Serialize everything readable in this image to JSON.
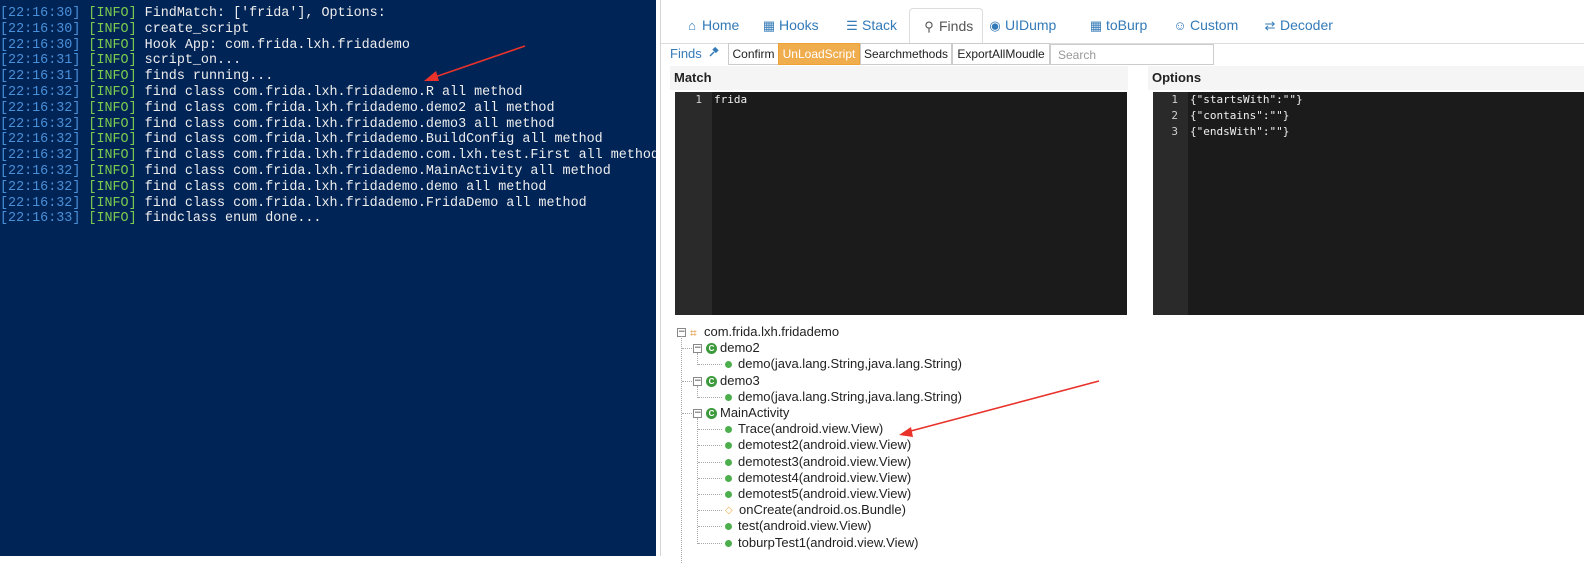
{
  "terminal": {
    "lines": [
      {
        "time": "[22:16:30]",
        "level": "[INFO]",
        "msg": "FindMatch: ['frida'], Options:"
      },
      {
        "time": "[22:16:30]",
        "level": "[INFO]",
        "msg": "create_script"
      },
      {
        "time": "[22:16:30]",
        "level": "[INFO]",
        "msg": "Hook App: com.frida.lxh.fridademo"
      },
      {
        "time": "[22:16:31]",
        "level": "[INFO]",
        "msg": "script_on..."
      },
      {
        "time": "[22:16:31]",
        "level": "[INFO]",
        "msg": "finds running..."
      },
      {
        "time": "[22:16:32]",
        "level": "[INFO]",
        "msg": "find class com.frida.lxh.fridademo.R all method"
      },
      {
        "time": "[22:16:32]",
        "level": "[INFO]",
        "msg": "find class com.frida.lxh.fridademo.demo2 all method"
      },
      {
        "time": "[22:16:32]",
        "level": "[INFO]",
        "msg": "find class com.frida.lxh.fridademo.demo3 all method"
      },
      {
        "time": "[22:16:32]",
        "level": "[INFO]",
        "msg": "find class com.frida.lxh.fridademo.BuildConfig all method"
      },
      {
        "time": "[22:16:32]",
        "level": "[INFO]",
        "msg": "find class com.frida.lxh.fridademo.com.lxh.test.First all method"
      },
      {
        "time": "[22:16:32]",
        "level": "[INFO]",
        "msg": "find class com.frida.lxh.fridademo.MainActivity all method"
      },
      {
        "time": "[22:16:32]",
        "level": "[INFO]",
        "msg": "find class com.frida.lxh.fridademo.demo all method"
      },
      {
        "time": "[22:16:32]",
        "level": "[INFO]",
        "msg": "find class com.frida.lxh.fridademo.FridaDemo all method"
      },
      {
        "time": "[22:16:33]",
        "level": "[INFO]",
        "msg": "findclass enum done..."
      }
    ]
  },
  "tabs": [
    {
      "label": "Home",
      "icon": "home-icon"
    },
    {
      "label": "Hooks",
      "icon": "grid-icon"
    },
    {
      "label": "Stack",
      "icon": "stack-icon"
    },
    {
      "label": "Finds",
      "icon": "search-icon",
      "active": true
    },
    {
      "label": "UIDump",
      "icon": "eye-icon"
    },
    {
      "label": "toBurp",
      "icon": "grid-icon"
    },
    {
      "label": "Custom",
      "icon": "user-icon"
    },
    {
      "label": "Decoder",
      "icon": "swap-icon"
    }
  ],
  "toolbar": {
    "finds_label": "Finds",
    "pin_icon": "pin-icon",
    "buttons": [
      "Confirm",
      "UnLoadScript",
      "Searchmethods",
      "ExportAllMoudle"
    ],
    "active_button": "UnLoadScript",
    "search_placeholder": "Search"
  },
  "match": {
    "title": "Match",
    "lines": [
      {
        "num": "1",
        "text": "frida"
      }
    ]
  },
  "options": {
    "title": "Options",
    "lines": [
      {
        "num": "1",
        "text": "{\"startsWith\":\"\"}"
      },
      {
        "num": "2",
        "text": "{\"contains\":\"\"}"
      },
      {
        "num": "3",
        "text": "{\"endsWith\":\"\"}"
      }
    ]
  },
  "tree": {
    "root": "com.frida.lxh.fridademo",
    "classes": [
      {
        "name": "demo2",
        "methods": [
          {
            "label": "demo(java.lang.String,java.lang.String)",
            "kind": "public"
          }
        ]
      },
      {
        "name": "demo3",
        "methods": [
          {
            "label": "demo(java.lang.String,java.lang.String)",
            "kind": "public"
          }
        ]
      },
      {
        "name": "MainActivity",
        "methods": [
          {
            "label": "Trace(android.view.View)",
            "kind": "public"
          },
          {
            "label": "demotest2(android.view.View)",
            "kind": "public"
          },
          {
            "label": "demotest3(android.view.View)",
            "kind": "public"
          },
          {
            "label": "demotest4(android.view.View)",
            "kind": "public"
          },
          {
            "label": "demotest5(android.view.View)",
            "kind": "public"
          },
          {
            "label": "onCreate(android.os.Bundle)",
            "kind": "protected"
          },
          {
            "label": "test(android.view.View)",
            "kind": "public"
          },
          {
            "label": "toburpTest1(android.view.View)",
            "kind": "public"
          }
        ]
      }
    ]
  },
  "colors": {
    "terminal_bg": "#012456",
    "link_blue": "#337ab7",
    "button_orange": "#f0ad4e",
    "annotation_red": "#e8322a"
  }
}
